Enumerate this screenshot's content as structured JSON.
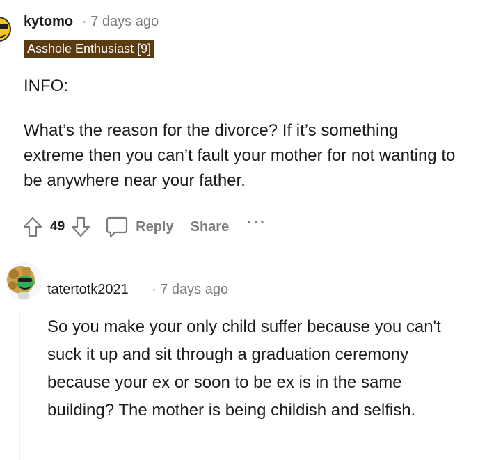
{
  "comment1": {
    "author": "kytomo",
    "separator": "·",
    "time": "7 days ago",
    "flair": "Asshole Enthusiast [9]",
    "paragraphs": [
      "INFO:",
      "What’s the reason for the divorce? If it’s something extreme then you can’t fault your mother for not wanting to be anywhere near your father."
    ],
    "actions": {
      "vote_count": "49",
      "reply_label": "Reply",
      "share_label": "Share",
      "more_label": "···"
    }
  },
  "comment2": {
    "author": "tatertotk2021",
    "separator": "·",
    "time": "7 days ago",
    "body": "So you make your only child suffer because you can't suck it up and sit through a graduation ceremony because your ex or soon to be ex is in the same building? The mother is being childish and selfish."
  },
  "icons": {
    "upvote": "arrow-up-icon",
    "downvote": "arrow-down-icon",
    "reply": "speech-bubble-icon",
    "more": "ellipsis-icon"
  },
  "colors": {
    "text": "#1c1c1c",
    "meta": "#7c7c7c",
    "flair_bg": "#5a3b12",
    "flair_text": "#ffffff",
    "thread_line": "#edeff1"
  }
}
